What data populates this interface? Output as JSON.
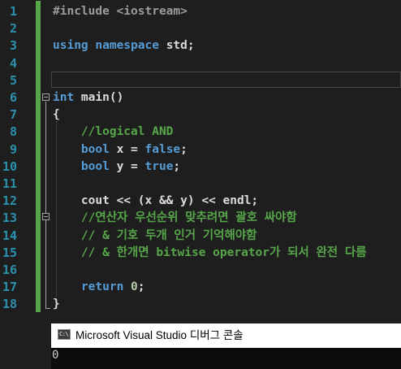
{
  "editor": {
    "line_numbers": [
      "1",
      "2",
      "3",
      "4",
      "5",
      "6",
      "7",
      "8",
      "9",
      "10",
      "11",
      "12",
      "13",
      "14",
      "15",
      "16",
      "17",
      "18"
    ],
    "lines": [
      [
        {
          "t": "#include <iostream>",
          "c": "pp"
        }
      ],
      [],
      [
        {
          "t": "using namespace ",
          "c": "kw"
        },
        {
          "t": "std;",
          "c": "tx"
        }
      ],
      [],
      [],
      [
        {
          "t": "int",
          "c": "kw"
        },
        {
          "t": " main()",
          "c": "tx"
        }
      ],
      [
        {
          "t": "{",
          "c": "tx"
        }
      ],
      [
        {
          "t": "    //logical AND",
          "c": "cm"
        }
      ],
      [
        {
          "t": "    ",
          "c": "tx"
        },
        {
          "t": "bool",
          "c": "kw"
        },
        {
          "t": " x = ",
          "c": "tx"
        },
        {
          "t": "false",
          "c": "kw"
        },
        {
          "t": ";",
          "c": "tx"
        }
      ],
      [
        {
          "t": "    ",
          "c": "tx"
        },
        {
          "t": "bool",
          "c": "kw"
        },
        {
          "t": " y = ",
          "c": "tx"
        },
        {
          "t": "true",
          "c": "kw"
        },
        {
          "t": ";",
          "c": "tx"
        }
      ],
      [],
      [
        {
          "t": "    cout << (x && y) << endl;",
          "c": "tx"
        }
      ],
      [
        {
          "t": "    //연산자 우선순위 맞추려면 괄호 싸야함",
          "c": "cm"
        }
      ],
      [
        {
          "t": "    // & 기호 두개 인거 기억해야함",
          "c": "cm"
        }
      ],
      [
        {
          "t": "    // & 한개면 bitwise operator가 되서 완전 다름",
          "c": "cm"
        }
      ],
      [],
      [
        {
          "t": "    ",
          "c": "tx"
        },
        {
          "t": "return",
          "c": "kw"
        },
        {
          "t": " ",
          "c": "tx"
        },
        {
          "t": "0",
          "c": "num"
        },
        {
          "t": ";",
          "c": "tx"
        }
      ],
      [
        {
          "t": "}",
          "c": "tx"
        }
      ]
    ]
  },
  "console": {
    "icon_label": "C:\\",
    "title": "Microsoft Visual Studio 디버그 콘솔",
    "output": "0"
  }
}
